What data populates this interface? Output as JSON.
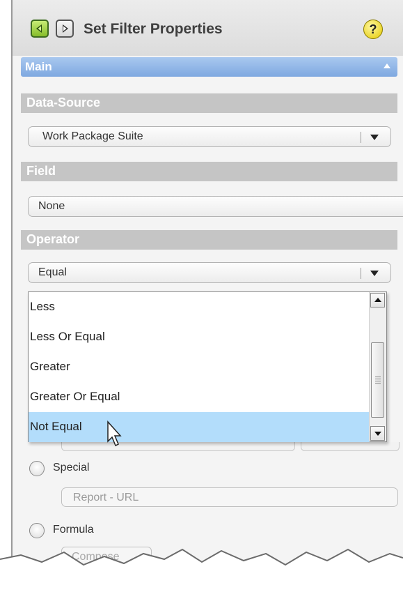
{
  "dialog": {
    "title": "Set Filter Properties",
    "help_label": "?",
    "back_icon": "arrow-left-icon",
    "forward_icon": "arrow-right-icon"
  },
  "main_section": {
    "label": "Main"
  },
  "data_source": {
    "label": "Data-Source",
    "value": "Work Package Suite"
  },
  "field": {
    "label": "Field",
    "value": "None"
  },
  "operator": {
    "label": "Operator",
    "value": "Equal",
    "options": [
      "Less",
      "Less Or Equal",
      "Greater",
      "Greater Or Equal",
      "Not Equal"
    ],
    "highlighted": "Not Equal"
  },
  "value_options": {
    "special_label": "Special",
    "special_value": "Report - URL",
    "formula_label": "Formula",
    "compose_label": "Compose"
  },
  "colors": {
    "highlight": "#b3ddfb",
    "header": "#7ea8e0",
    "section": "#c5c5c5",
    "accent_green": "#86bd2a"
  }
}
